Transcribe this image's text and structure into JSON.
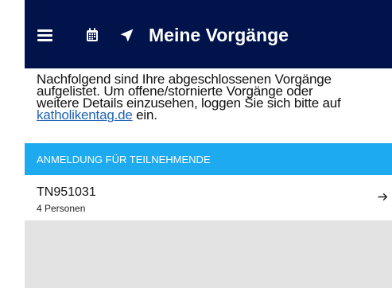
{
  "appbar": {
    "title": "Meine Vorgänge",
    "icons": [
      "menu-icon",
      "calendar-icon",
      "navigation-arrow-icon"
    ],
    "background_color": "#00134a"
  },
  "intro": {
    "line1": "Nachfolgend sind Ihre abgeschlossenen Vorgänge",
    "line2": "aufgelistet. Um offene/stornierte Vorgänge oder",
    "line3": "weitere Details einzusehen, loggen Sie sich bitte auf",
    "link_text": "katholikentag.de",
    "after_link": " ein."
  },
  "section": {
    "header": "ANMELDUNG FÜR TEILNEHMENDE",
    "background_color": "#1eaaee"
  },
  "orders": [
    {
      "id": "TN951031",
      "persons": "4 Personen",
      "icon": "arrow-right-icon"
    }
  ],
  "colors": {
    "link": "#1e62b4",
    "empty_background": "#e3e3e3"
  }
}
